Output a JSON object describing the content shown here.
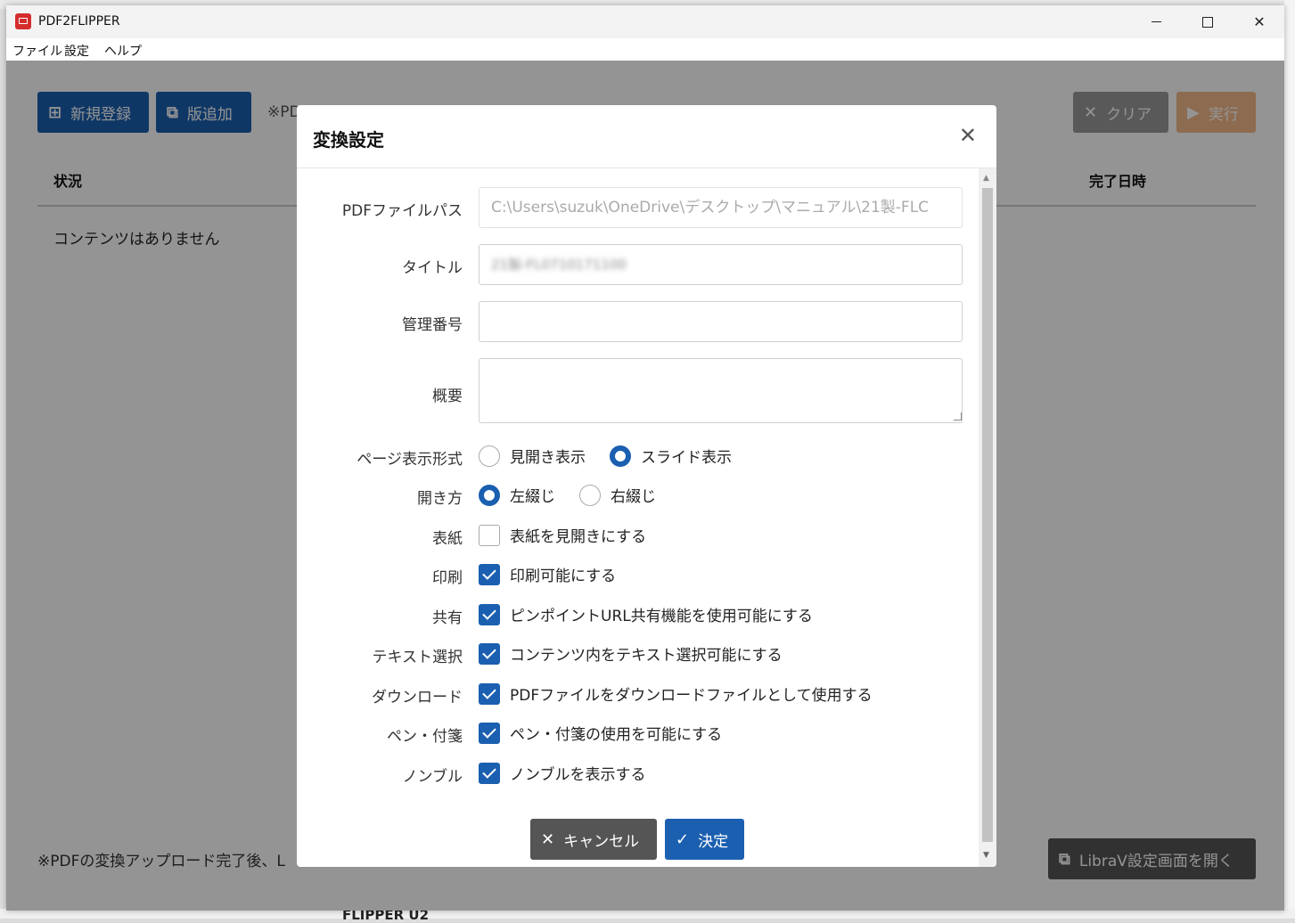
{
  "window": {
    "title": "PDF2FLIPPER",
    "menu": [
      "ファイル",
      "設定",
      "ヘルプ"
    ]
  },
  "toolbar": {
    "new_label": "新規登録",
    "add_label": "版追加",
    "note": "※PD",
    "clear_label": "クリア",
    "run_label": "実行"
  },
  "table": {
    "col_status": "状況",
    "col_done": "完了日時",
    "empty": "コンテンツはありません"
  },
  "bottom": {
    "note": "※PDFの変換アップロード完了後、L",
    "librav_label": "LibraV設定画面を開く",
    "partial_text": "FLIPPER U2"
  },
  "modal": {
    "title": "変換設定",
    "fields": {
      "pdf_path_label": "PDFファイルパス",
      "pdf_path_value": "C:\\Users\\suzuk\\OneDrive\\デスクトップ\\マニュアル\\21製-FLC",
      "title_label": "タイトル",
      "title_value": "21製-FL0710171100",
      "manage_label": "管理番号",
      "manage_value": "",
      "summary_label": "概要",
      "summary_value": ""
    },
    "page_format": {
      "label": "ページ表示形式",
      "opt1": "見開き表示",
      "opt2": "スライド表示",
      "selected": "スライド表示"
    },
    "open_dir": {
      "label": "開き方",
      "opt1": "左綴じ",
      "opt2": "右綴じ",
      "selected": "左綴じ"
    },
    "checks": [
      {
        "label": "表紙",
        "text": "表紙を見開きにする",
        "checked": false
      },
      {
        "label": "印刷",
        "text": "印刷可能にする",
        "checked": true
      },
      {
        "label": "共有",
        "text": "ピンポイントURL共有機能を使用可能にする",
        "checked": true
      },
      {
        "label": "テキスト選択",
        "text": "コンテンツ内をテキスト選択可能にする",
        "checked": true
      },
      {
        "label": "ダウンロード",
        "text": "PDFファイルをダウンロードファイルとして使用する",
        "checked": true
      },
      {
        "label": "ペン・付箋",
        "text": "ペン・付箋の使用を可能にする",
        "checked": true
      },
      {
        "label": "ノンブル",
        "text": "ノンブルを表示する",
        "checked": true
      }
    ],
    "cancel_label": "キャンセル",
    "ok_label": "決定"
  },
  "colors": {
    "primary": "#1b5fb0",
    "cancel": "#555555",
    "overlay": "rgba(0,0,0,0.42)"
  }
}
